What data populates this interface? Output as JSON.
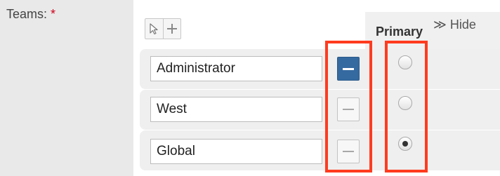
{
  "field": {
    "label": "Teams:",
    "required_mark": "*"
  },
  "toolbar": {
    "select_icon": "cursor-arrow-icon",
    "add_icon": "plus-icon"
  },
  "column": {
    "primary_label": "Primary",
    "hide_label": "≫ Hide"
  },
  "teams": [
    {
      "name": "Administrator",
      "remove_active": true,
      "primary": false
    },
    {
      "name": "West",
      "remove_active": false,
      "primary": false
    },
    {
      "name": "Global",
      "remove_active": false,
      "primary": true
    }
  ],
  "highlight_color": "#ff3b1f",
  "remove_active_color": "#356aa0"
}
